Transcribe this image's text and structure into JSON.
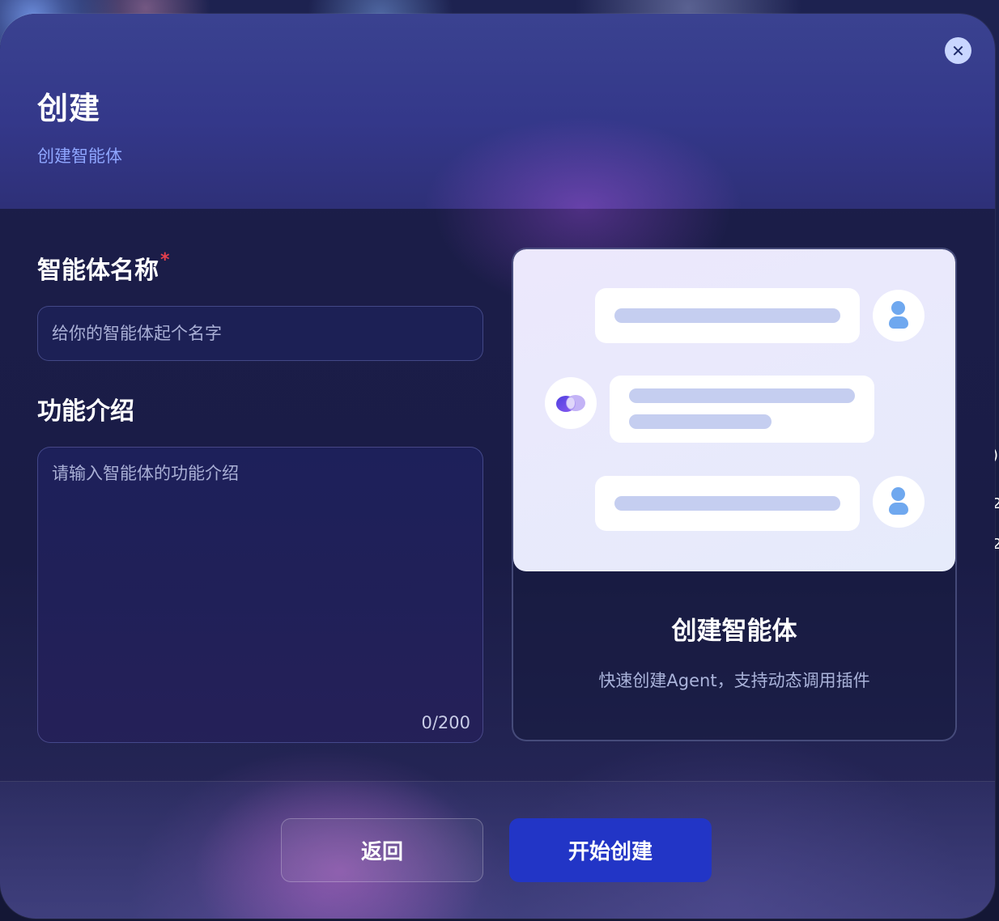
{
  "dialog": {
    "title": "创建",
    "subtitle": "创建智能体",
    "close_icon": "close-icon"
  },
  "form": {
    "name_label": "智能体名称",
    "name_required_mark": "*",
    "name_placeholder": "给你的智能体起个名字",
    "name_value": "",
    "desc_label": "功能介绍",
    "desc_placeholder": "请输入智能体的功能介绍",
    "desc_value": "",
    "desc_counter": "0/200"
  },
  "card": {
    "title": "创建智能体",
    "description": "快速创建Agent，支持动态调用插件",
    "icons": [
      "user-avatar-icon",
      "agent-logo-icon"
    ]
  },
  "footer": {
    "back_label": "返回",
    "create_label": "开始创建"
  },
  "colors": {
    "accent": "#2235c6",
    "subtitle": "#8fa6ff",
    "required": "#e5404d"
  }
}
